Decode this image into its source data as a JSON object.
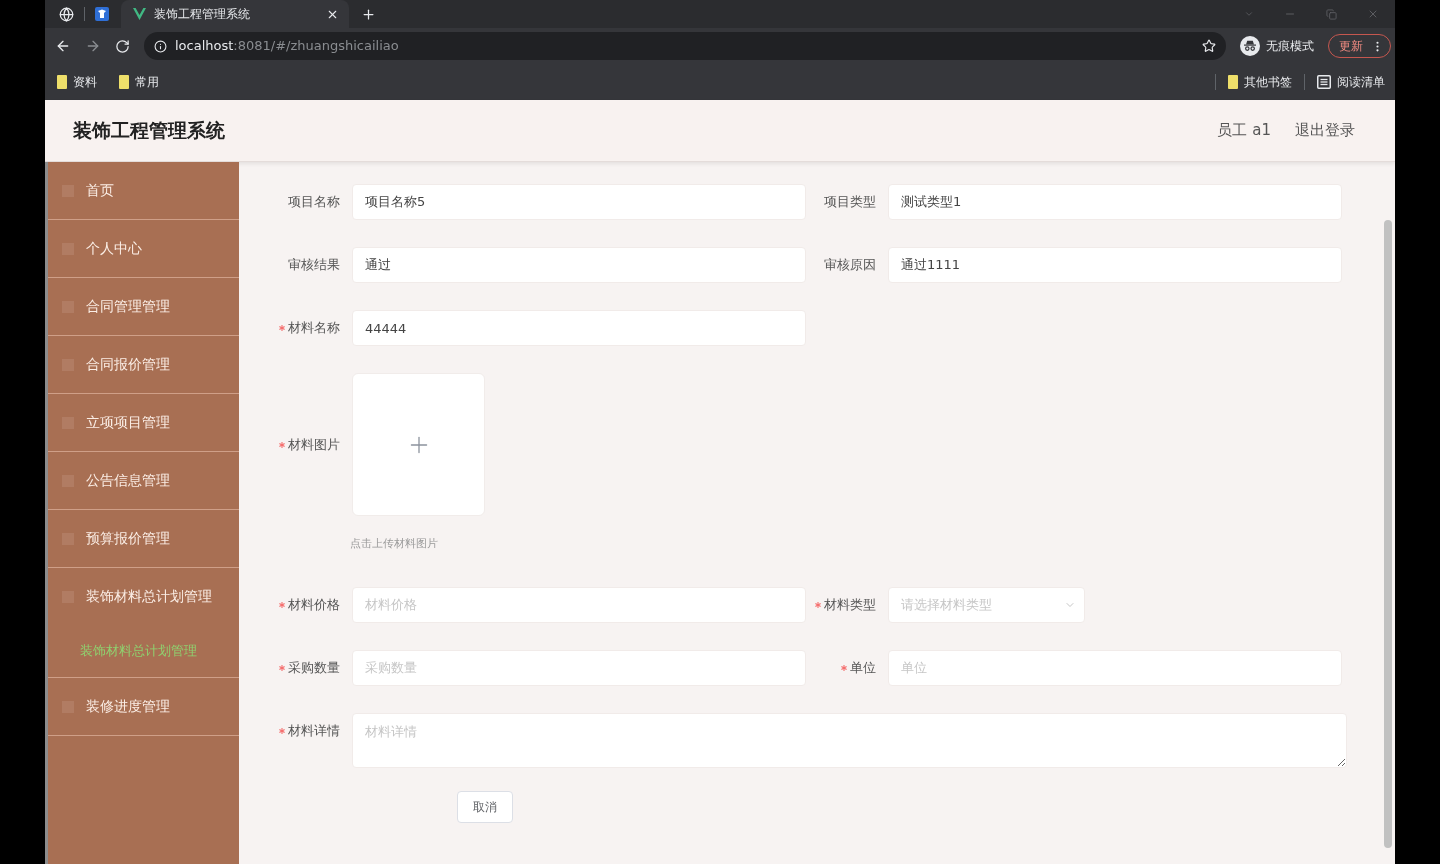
{
  "browser": {
    "tabs": [
      {
        "title": "装饰工程管理系统",
        "selected": true
      }
    ],
    "address": {
      "host": "localhost",
      "rest": ":8081/#/zhuangshicailiao"
    },
    "profile": {
      "label": "无痕模式"
    },
    "update_button": {
      "label": "更新"
    },
    "bookmarks_left": [
      {
        "label": "资料",
        "kind": "folder"
      },
      {
        "label": "常用",
        "kind": "folder"
      }
    ],
    "bookmarks_right": [
      {
        "label": "其他书签",
        "kind": "folder"
      },
      {
        "label": "阅读清单",
        "kind": "reading_list"
      }
    ]
  },
  "app": {
    "title": "装饰工程管理系统",
    "user": "员工 a1",
    "logout": "退出登录"
  },
  "sidebar": {
    "items": [
      {
        "label": "首页",
        "selected": false
      },
      {
        "label": "个人中心",
        "selected": false
      },
      {
        "label": "合同管理管理",
        "selected": false
      },
      {
        "label": "合同报价管理",
        "selected": false
      },
      {
        "label": "立项项目管理",
        "selected": false
      },
      {
        "label": "公告信息管理",
        "selected": false
      },
      {
        "label": "预算报价管理",
        "selected": false
      },
      {
        "label": "装饰材料总计划管理",
        "selected": false,
        "expanded": true,
        "children": [
          {
            "label": "装饰材料总计划管理",
            "selected": true
          }
        ]
      },
      {
        "label": "装修进度管理",
        "selected": false
      }
    ]
  },
  "form": {
    "rows": [
      {
        "fields": [
          {
            "kind": "text",
            "label": "项目名称",
            "value": "项目名称5",
            "required": false
          },
          {
            "kind": "text",
            "label": "项目类型",
            "value": "测试类型1",
            "required": false
          }
        ]
      },
      {
        "fields": [
          {
            "kind": "text",
            "label": "审核结果",
            "value": "通过",
            "required": false
          },
          {
            "kind": "text",
            "label": "审核原因",
            "value": "通过1111",
            "required": false
          }
        ]
      },
      {
        "fields": [
          {
            "kind": "text",
            "label": "材料名称",
            "value": "44444",
            "required": true
          }
        ]
      },
      {
        "fields": [
          {
            "kind": "upload",
            "label": "材料图片",
            "hint": "点击上传材料图片",
            "required": true
          }
        ]
      },
      {
        "fields": [
          {
            "kind": "text",
            "label": "材料价格",
            "placeholder": "材料价格",
            "required": true
          },
          {
            "kind": "select",
            "label": "材料类型",
            "placeholder": "请选择材料类型",
            "required": true
          }
        ]
      },
      {
        "fields": [
          {
            "kind": "text",
            "label": "采购数量",
            "placeholder": "采购数量",
            "required": true
          },
          {
            "kind": "text",
            "label": "单位",
            "placeholder": "单位",
            "required": true
          }
        ]
      },
      {
        "fields": [
          {
            "kind": "textarea",
            "label": "材料详情",
            "placeholder": "材料详情",
            "required": true
          }
        ]
      }
    ],
    "buttons": [
      {
        "label": "取消"
      }
    ]
  }
}
